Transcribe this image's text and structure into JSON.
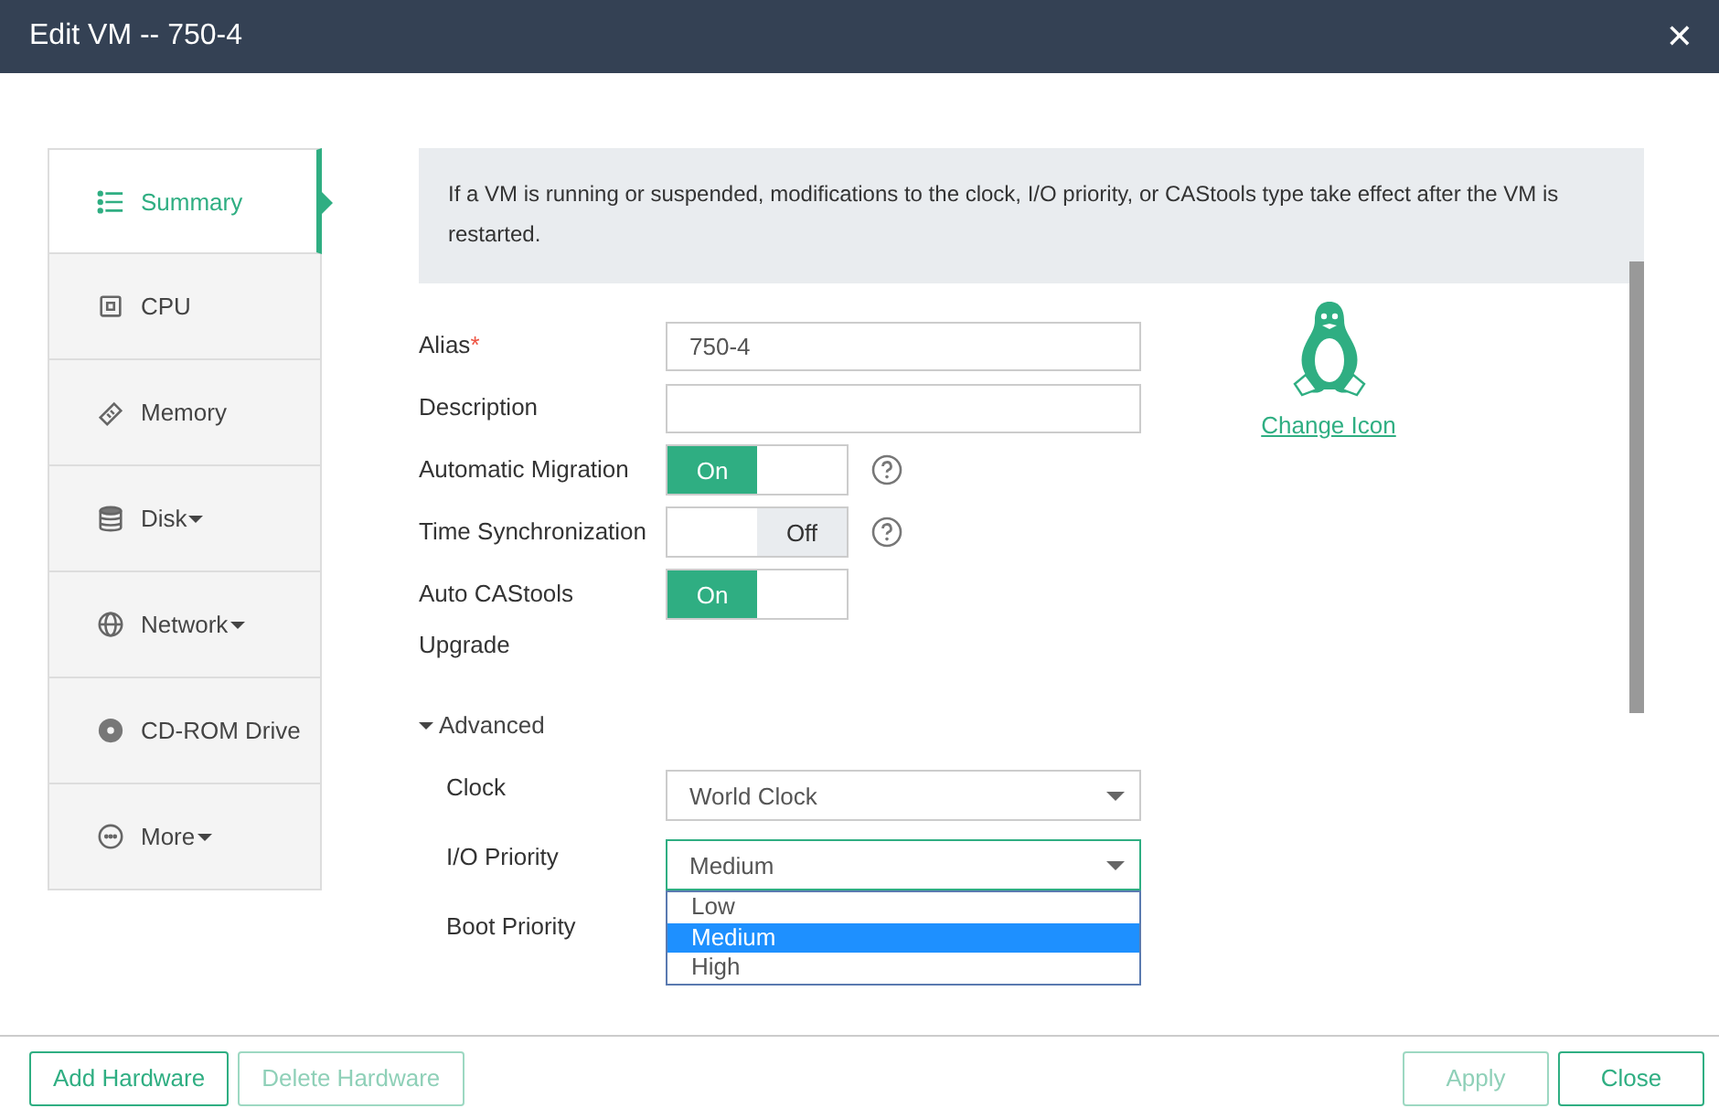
{
  "window": {
    "title": "Edit VM -- 750-4",
    "close": "✕"
  },
  "sidebar": {
    "items": [
      {
        "kind": "list",
        "label": "Summary",
        "selected": true,
        "dropdown": false
      },
      {
        "kind": "cpu",
        "label": "CPU",
        "selected": false,
        "dropdown": false
      },
      {
        "kind": "memory",
        "label": "Memory",
        "selected": false,
        "dropdown": false
      },
      {
        "kind": "disk",
        "label": "Disk",
        "selected": false,
        "dropdown": true
      },
      {
        "kind": "network",
        "label": "Network",
        "selected": false,
        "dropdown": true
      },
      {
        "kind": "cdrom",
        "label": "CD-ROM Drive",
        "selected": false,
        "dropdown": false
      },
      {
        "kind": "more",
        "label": "More",
        "selected": false,
        "dropdown": true
      }
    ]
  },
  "notice": "If a VM is running or suspended, modifications to the clock, I/O priority, or CAStools type take effect after the VM is restarted.",
  "form": {
    "fields": [
      {
        "kind": "text",
        "label": "Alias",
        "required_mark": "*",
        "value": "750-4"
      },
      {
        "kind": "text",
        "label": "Description"
      },
      {
        "kind": "toggle",
        "label": "Automatic Migration",
        "on": true,
        "state_text": "On",
        "help": true
      },
      {
        "kind": "toggle",
        "label": "Time Synchronization",
        "on": false,
        "state_text": "Off",
        "help": true
      },
      {
        "kind": "toggle",
        "label": "Auto CAStools Upgrade",
        "on": true,
        "state_text": "On",
        "help": false
      }
    ]
  },
  "advanced": {
    "label": "Advanced",
    "expanded": true,
    "fields": [
      {
        "kind": "select",
        "label": "Clock",
        "value": "World Clock",
        "open": false
      },
      {
        "kind": "select",
        "label": "I/O Priority",
        "value": "Medium",
        "open": true,
        "options": [
          {
            "label": "Low",
            "selected": false
          },
          {
            "label": "Medium",
            "selected": true
          },
          {
            "label": "High",
            "selected": false
          }
        ]
      },
      {
        "kind": "hidden",
        "label": "Boot Priority"
      }
    ]
  },
  "icon_link": "Change Icon",
  "footer": {
    "left": [
      {
        "label": "Add Hardware",
        "disabled": false
      },
      {
        "label": "Delete Hardware",
        "disabled": true
      }
    ],
    "right": [
      {
        "label": "Apply",
        "disabled": true
      },
      {
        "label": "Close",
        "disabled": false
      }
    ]
  }
}
